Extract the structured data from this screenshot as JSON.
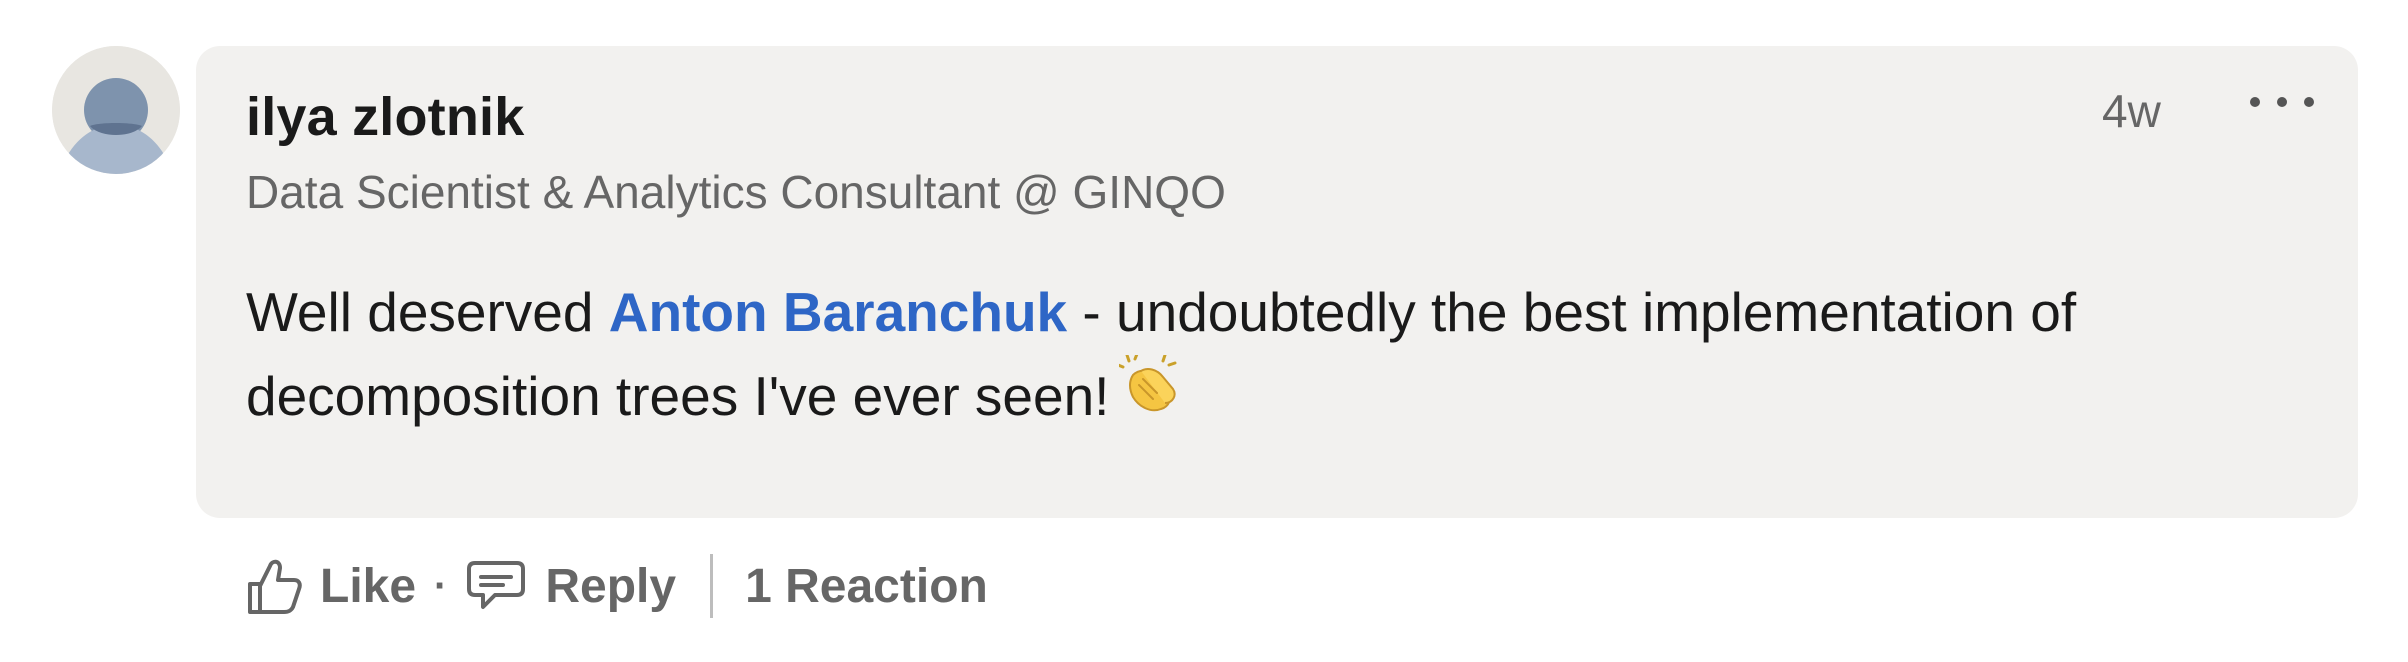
{
  "comment": {
    "author_name": "ilya zlotnik",
    "author_headline": "Data Scientist & Analytics Consultant @ GINQO",
    "timestamp": "4w",
    "text_before_mention": "Well deserved ",
    "mention": "Anton Baranchuk",
    "text_after_mention": " - undoubtedly the best implementation of decomposition trees I've ever seen!",
    "emoji": "clapping-hands"
  },
  "actions": {
    "like_label": "Like",
    "reply_label": "Reply",
    "reactions_label": "1 Reaction"
  },
  "colors": {
    "mention": "#2e66c6",
    "bubble": "#f2f1ef",
    "muted_text": "#666666"
  },
  "icons": [
    "avatar-placeholder",
    "more-options-icon",
    "like-thumb-icon",
    "reply-speech-icon",
    "clapping-hands-emoji"
  ]
}
